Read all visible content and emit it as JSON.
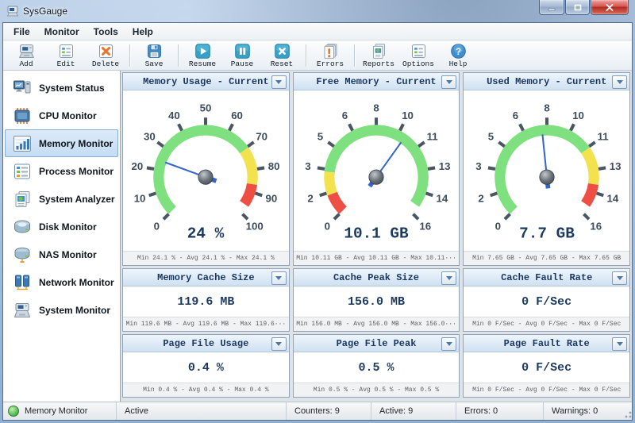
{
  "window": {
    "title": "SysGauge"
  },
  "menu": {
    "items": [
      "File",
      "Monitor",
      "Tools",
      "Help"
    ]
  },
  "toolbar": {
    "groups": [
      [
        {
          "icon": "add-icon",
          "label": "Add"
        },
        {
          "icon": "edit-icon",
          "label": "Edit"
        },
        {
          "icon": "delete-icon",
          "label": "Delete"
        }
      ],
      [
        {
          "icon": "save-icon",
          "label": "Save"
        }
      ],
      [
        {
          "icon": "resume-icon",
          "label": "Resume"
        },
        {
          "icon": "pause-icon",
          "label": "Pause"
        },
        {
          "icon": "reset-icon",
          "label": "Reset"
        }
      ],
      [
        {
          "icon": "errors-icon",
          "label": "Errors"
        }
      ],
      [
        {
          "icon": "reports-icon",
          "label": "Reports"
        },
        {
          "icon": "options-icon",
          "label": "Options"
        },
        {
          "icon": "help-icon",
          "label": "Help"
        }
      ]
    ]
  },
  "sidebar": {
    "items": [
      {
        "icon": "system-status-icon",
        "label": "System Status",
        "selected": false
      },
      {
        "icon": "cpu-monitor-icon",
        "label": "CPU Monitor",
        "selected": false
      },
      {
        "icon": "memory-monitor-icon",
        "label": "Memory Monitor",
        "selected": true
      },
      {
        "icon": "process-monitor-icon",
        "label": "Process Monitor",
        "selected": false
      },
      {
        "icon": "system-analyzer-icon",
        "label": "System Analyzer",
        "selected": false
      },
      {
        "icon": "disk-monitor-icon",
        "label": "Disk Monitor",
        "selected": false
      },
      {
        "icon": "nas-monitor-icon",
        "label": "NAS Monitor",
        "selected": false
      },
      {
        "icon": "network-monitor-icon",
        "label": "Network Monitor",
        "selected": false
      },
      {
        "icon": "system-monitor-icon",
        "label": "System Monitor",
        "selected": false
      }
    ]
  },
  "chart_data": [
    {
      "type": "gauge",
      "title": "Memory Usage - Current",
      "value": 24.1,
      "min": 0,
      "max": 100,
      "value_label": "24 %",
      "tick_labels": [
        "0",
        "10",
        "20",
        "30",
        "40",
        "50",
        "60",
        "70",
        "80",
        "90",
        "100"
      ],
      "bands": [
        {
          "color": "#7fe07f",
          "from": 0.0,
          "to": 0.705
        },
        {
          "color": "#f2e24e",
          "from": 0.705,
          "to": 0.865
        },
        {
          "color": "#ee4f44",
          "from": 0.865,
          "to": 0.962
        }
      ],
      "footer": "Min 24.1 % - Avg 24.1 % - Max 24.1 %"
    },
    {
      "type": "gauge",
      "title": "Free Memory - Current",
      "value": 10.11,
      "min": 0,
      "max": 16,
      "value_label": "10.1 GB",
      "tick_labels": [
        "0",
        "2",
        "3",
        "5",
        "6",
        "8",
        "10",
        "11",
        "13",
        "14",
        "16"
      ],
      "bands": [
        {
          "color": "#ee4f44",
          "from": 0.0,
          "to": 0.09
        },
        {
          "color": "#f2e24e",
          "from": 0.09,
          "to": 0.19
        },
        {
          "color": "#7fe07f",
          "from": 0.19,
          "to": 0.962
        }
      ],
      "footer": "Min 10.11 GB - Avg 10.11 GB - Max 10.11···"
    },
    {
      "type": "gauge",
      "title": "Used Memory - Current",
      "value": 7.65,
      "min": 0,
      "max": 16,
      "value_label": "7.7 GB",
      "tick_labels": [
        "0",
        "2",
        "3",
        "5",
        "6",
        "8",
        "10",
        "11",
        "13",
        "14",
        "16"
      ],
      "bands": [
        {
          "color": "#7fe07f",
          "from": 0.0,
          "to": 0.705
        },
        {
          "color": "#f2e24e",
          "from": 0.705,
          "to": 0.865
        },
        {
          "color": "#ee4f44",
          "from": 0.865,
          "to": 0.962
        }
      ],
      "footer": "Min 7.65 GB - Avg 7.65 GB - Max 7.65 GB"
    },
    {
      "type": "counter",
      "title": "Memory Cache Size",
      "value_label": "119.6 MB",
      "footer": "Min 119.6 MB - Avg 119.6 MB - Max 119.6···"
    },
    {
      "type": "counter",
      "title": "Cache Peak Size",
      "value_label": "156.0 MB",
      "footer": "Min 156.0 MB - Avg 156.0 MB - Max 156.0···"
    },
    {
      "type": "counter",
      "title": "Cache Fault Rate",
      "value_label": "0 F/Sec",
      "footer": "Min 0 F/Sec - Avg 0 F/Sec - Max 0 F/Sec"
    },
    {
      "type": "counter",
      "title": "Page File Usage",
      "value_label": "0.4 %",
      "footer": "Min 0.4 % - Avg 0.4 % - Max 0.4 %"
    },
    {
      "type": "counter",
      "title": "Page File Peak",
      "value_label": "0.5 %",
      "footer": "Min 0.5 % - Avg 0.5 % - Max 0.5 %"
    },
    {
      "type": "counter",
      "title": "Page Fault Rate",
      "value_label": "0 F/Sec",
      "footer": "Min 0 F/Sec - Avg 0 F/Sec - Max 0 F/Sec"
    }
  ],
  "status_bar": {
    "monitor": "Memory Monitor",
    "state": "Active",
    "counters": "Counters: 9",
    "active": "Active: 9",
    "errors": "Errors: 0",
    "warnings": "Warnings: 0"
  },
  "colors": {
    "gauge_green": "#7fe07f",
    "gauge_yellow": "#f2e24e",
    "gauge_red": "#ee4f44",
    "needle_blue": "#3565c8",
    "tick": "#4a5763",
    "header_text": "#18365f",
    "status_green": "#5cc05c"
  }
}
